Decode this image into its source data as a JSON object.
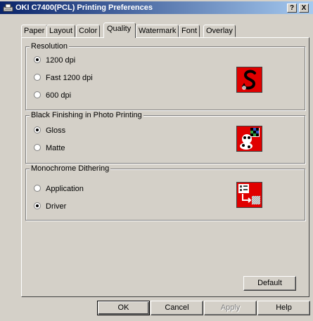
{
  "window": {
    "title": "OKI C7400(PCL) Printing Preferences",
    "help_label": "?",
    "close_label": "X"
  },
  "tabs": [
    {
      "label": "Paper"
    },
    {
      "label": "Layout"
    },
    {
      "label": "Color"
    },
    {
      "label": "Quality",
      "active": true
    },
    {
      "label": "Watermark"
    },
    {
      "label": "Font"
    },
    {
      "label": "Overlay"
    }
  ],
  "resolution": {
    "title": "Resolution",
    "options": [
      "1200 dpi",
      "Fast 1200 dpi",
      "600 dpi"
    ],
    "selected": "1200 dpi",
    "preview_icon": "resolution-s-icon"
  },
  "black_finishing": {
    "title": "Black Finishing in Photo Printing",
    "options": [
      "Gloss",
      "Matte"
    ],
    "selected": "Gloss",
    "preview_icon": "photo-finish-icon"
  },
  "monochrome": {
    "title": "Monochrome Dithering",
    "options": [
      "Application",
      "Driver"
    ],
    "selected": "Driver",
    "preview_icon": "dithering-icon"
  },
  "buttons": {
    "default": "Default",
    "ok": "OK",
    "cancel": "Cancel",
    "apply": "Apply",
    "help": "Help"
  },
  "colors": {
    "titlebar_start": "#0a246a",
    "titlebar_end": "#a6caf0",
    "face": "#d4d0c8",
    "preview_red": "#e00000"
  }
}
